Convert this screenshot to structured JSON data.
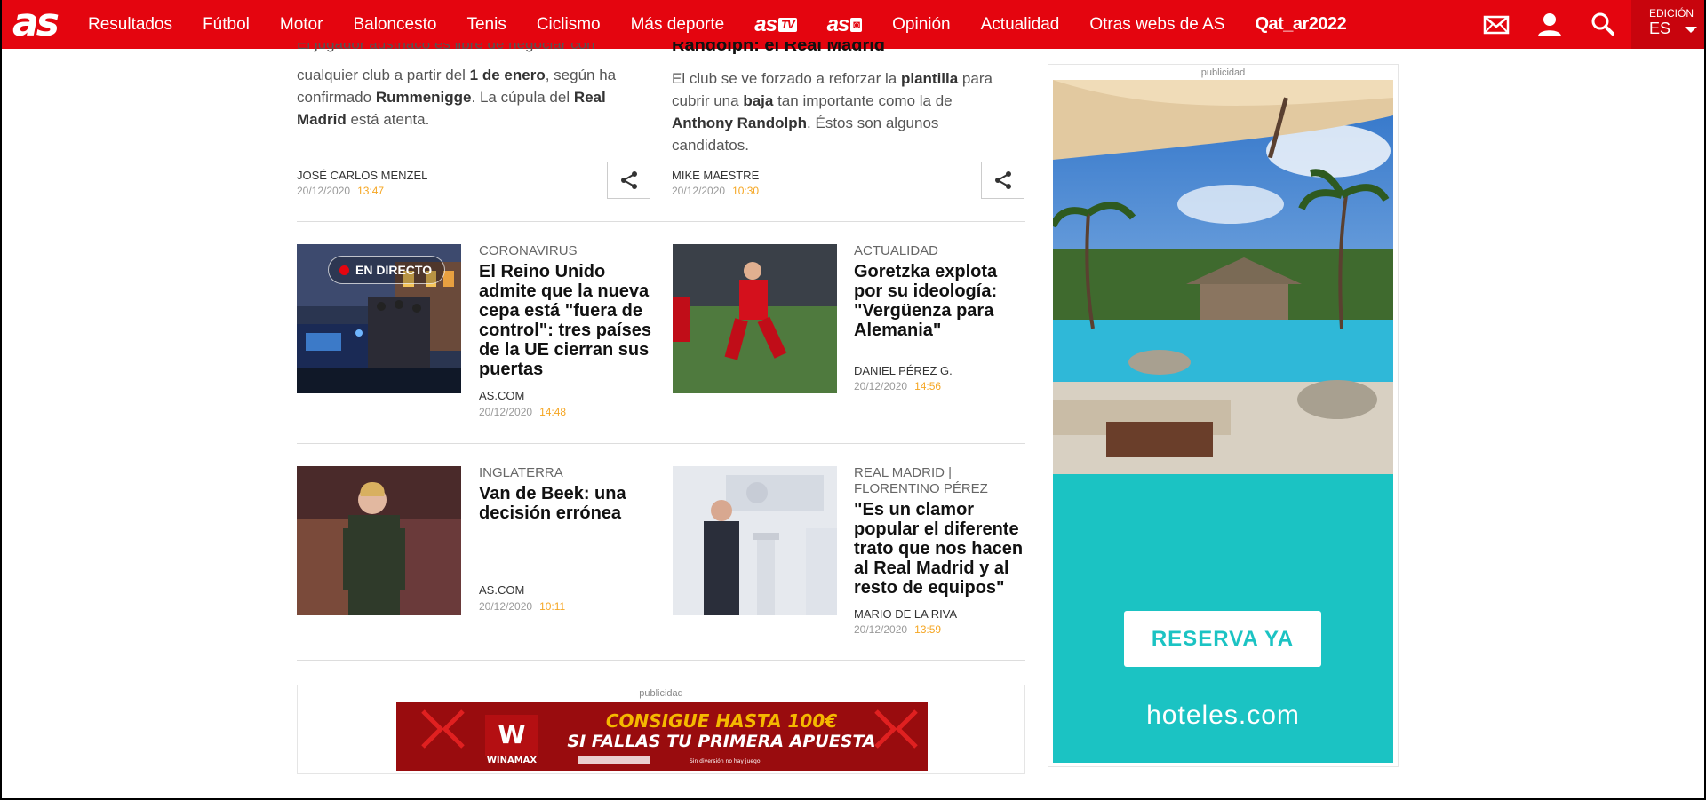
{
  "header": {
    "logo": "as",
    "nav": [
      "Resultados",
      "Fútbol",
      "Motor",
      "Baloncesto",
      "Tenis",
      "Ciclismo",
      "Más deporte"
    ],
    "astv": {
      "main": "as",
      "tag": "TV"
    },
    "asfoto": {
      "main": "as",
      "tag": "◙"
    },
    "nav2": [
      "Opinión",
      "Actualidad",
      "Otras webs de AS"
    ],
    "qatar": "Qat_ar2022",
    "edition_label": "EDICIÓN",
    "edition_value": "ES"
  },
  "top_articles": [
    {
      "headline": "El jugador austriaco es libre de negociar con",
      "summary_parts": [
        "cualquier club a partir del ",
        "1 de enero",
        ", según ha confirmado ",
        "Rummenigge",
        ". La cúpula del ",
        "Real Madrid",
        " está atenta."
      ],
      "author": "JOSÉ CARLOS MENZEL",
      "date": "20/12/2020",
      "time": "13:47"
    },
    {
      "headline": "Randolph: el Real Madrid",
      "summary_parts": [
        "El club se ve forzado a reforzar la ",
        "plantilla",
        " para cubrir una ",
        "baja",
        " tan importante como la de ",
        "Anthony Randolph",
        ". Éstos son algunos candidatos."
      ],
      "author": "MIKE MAESTRE",
      "date": "20/12/2020",
      "time": "10:30"
    }
  ],
  "live_badge": "EN DIRECTO",
  "articles": [
    {
      "kicker": "CORONAVIRUS",
      "title": "El Reino Unido admite que la nueva cepa está \"fuera de control\": tres países de la UE cierran sus puertas",
      "author": "AS.COM",
      "date": "20/12/2020",
      "time": "14:48"
    },
    {
      "kicker": "ACTUALIDAD",
      "title": "Goretzka explota por su ideología: \"Vergüenza para Alemania\"",
      "author": "DANIEL PÉREZ G.",
      "date": "20/12/2020",
      "time": "14:56"
    },
    {
      "kicker": "INGLATERRA",
      "title": "Van de Beek: una decisión errónea",
      "author": "AS.COM",
      "date": "20/12/2020",
      "time": "10:11"
    },
    {
      "kicker": "REAL MADRID | FLORENTINO PÉREZ",
      "title": "\"Es un clamor popular el diferente trato que nos hacen al Real Madrid y al resto de equipos\"",
      "author": "MARIO DE LA RIVA",
      "date": "20/12/2020",
      "time": "13:59"
    }
  ],
  "ads": {
    "label": "publicidad",
    "side_cta": "RESERVA YA",
    "side_brand": "hoteles.com",
    "banner_logo": "WINAMAX",
    "banner_line1": "CONSIGUE HASTA 100€",
    "banner_line2": "SI FALLAS TU PRIMERA APUESTA",
    "banner_fine": "Sin diversión no hay juego"
  },
  "colors": {
    "brand_red": "#e4050f",
    "time_orange": "#f5a623",
    "teal": "#1bc3c3"
  }
}
